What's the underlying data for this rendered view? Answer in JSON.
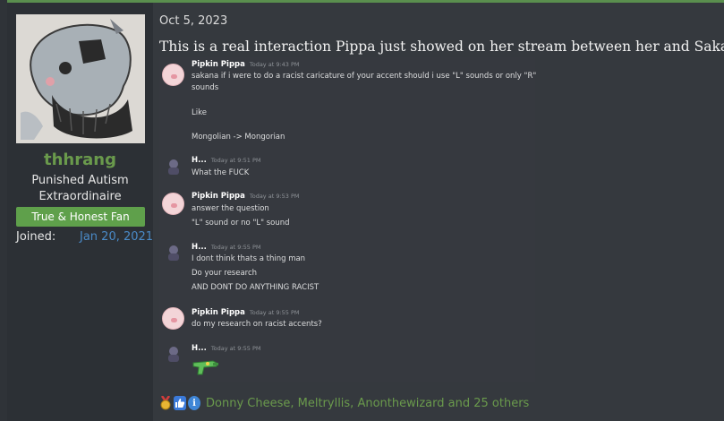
{
  "user": {
    "name": "thhrang",
    "title": "Punished Autism Extraordinaire",
    "banner": "True & Honest Fan",
    "joined_label": "Joined:",
    "joined_value": "Jan 20, 2021"
  },
  "post": {
    "date": "Oct 5, 2023",
    "text": "This is a real interaction Pippa just showed on her stream between her and Sakana."
  },
  "discord": {
    "messages": [
      {
        "author": "Pipkin Pippa",
        "time": "Today at 9:43 PM",
        "lines": [
          "sakana if i were to do a racist caricature of your accent should i use \"L\" sounds or only \"R\"",
          "sounds",
          "",
          "Like",
          "",
          "Mongolian -> Mongorian"
        ]
      },
      {
        "author": "H...",
        "time": "Today at 9:51 PM",
        "lines": [
          "What the FUCK"
        ]
      },
      {
        "author": "Pipkin Pippa",
        "time": "Today at 9:53 PM",
        "lines": [
          "answer the question",
          "\"L\" sound or no \"L\" sound"
        ]
      },
      {
        "author": "H...",
        "time": "Today at 9:55 PM",
        "lines": [
          "I dont think thats a thing man",
          "Do your research",
          "AND DONT DO ANYTHING RACIST"
        ]
      },
      {
        "author": "Pipkin Pippa",
        "time": "Today at 9:55 PM",
        "lines": [
          "do my research on racist accents?"
        ]
      },
      {
        "author": "H...",
        "time": "Today at 9:55 PM",
        "lines": []
      }
    ]
  },
  "reactions": {
    "icons": [
      "medal-icon",
      "like-icon",
      "info-icon"
    ],
    "text": "Donny Cheese, Meltryllis, Anonthewizard and 25 others"
  },
  "colors": {
    "username": "#6a9a4c",
    "banner": "#5fa04b",
    "joined_date": "#4a8ac7",
    "background": "#35393e",
    "discord_bg": "#36393f"
  }
}
